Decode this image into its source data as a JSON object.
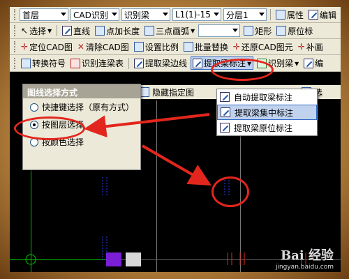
{
  "toolbar1": {
    "floor": "首层",
    "cad_recognize": "CAD识别",
    "recognize_beam": "识别梁",
    "beam_name": "L1(1)-15",
    "layer": "分层1",
    "properties": "属性",
    "edit": "编辑"
  },
  "toolbar2": {
    "select": "选择",
    "line": "直线",
    "add_length": "点加长度",
    "arc": "三点画弧",
    "rect": "矩形",
    "origin": "原位标"
  },
  "toolbar3": {
    "locate_cad": "定位CAD图",
    "clear_cad": "清除CAD图",
    "set_scale": "设置比例",
    "batch_replace": "批量替换",
    "restore_cad": "还原CAD图元",
    "fill": "补画"
  },
  "toolbar4": {
    "convert_symbol": "转换符号",
    "recognize_beam_table": "识别连梁表",
    "extract_beam_edge": "提取梁边线",
    "extract_beam_label": "提取梁标注",
    "recognize_beam": "识别梁",
    "more": "编"
  },
  "panel": {
    "title": "图线选择方式",
    "options": [
      "快捷键选择（原有方式）",
      "按图层选择",
      "按颜色选择"
    ],
    "selected_index": 1
  },
  "menu": {
    "items": [
      "自动提取梁标注",
      "提取梁集中标注",
      "提取梁原位标注"
    ],
    "selected_index": 1
  },
  "canvas_labels": {
    "layer_tab": "层",
    "hide_drawing": "隐藏指定图",
    "select_tab": "选"
  },
  "watermark": {
    "logo": "Bai 经验",
    "url": "jingyan.baidu.com"
  },
  "colors": {
    "annotation_red": "#e3261d",
    "toolbar_bg": "#ece9d8",
    "highlight": "#c1d2ee",
    "canvas": "#000000"
  }
}
